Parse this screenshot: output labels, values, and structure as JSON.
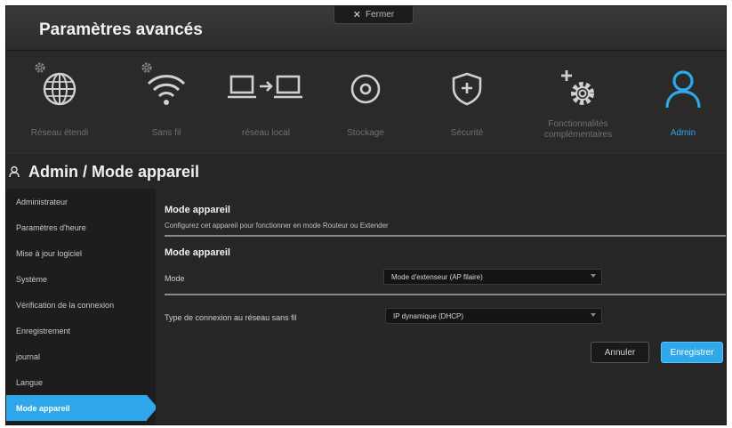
{
  "window": {
    "title": "Paramètres avancés",
    "close_label": "Fermer"
  },
  "nav": {
    "items": [
      {
        "label": "Réseau étendi",
        "icon": "globe-icon"
      },
      {
        "label": "Sans fil",
        "icon": "wifi-icon"
      },
      {
        "label": "réseau local",
        "icon": "lan-icon"
      },
      {
        "label": "Stockage",
        "icon": "storage-icon"
      },
      {
        "label": "Sécurité",
        "icon": "shield-icon"
      },
      {
        "label": "Fonctionnalités complémentaires",
        "icon": "gear-plus-icon"
      },
      {
        "label": "Admin",
        "icon": "user-icon"
      }
    ],
    "active_index": 6,
    "accent_color": "#2ea8ea"
  },
  "page": {
    "title": "Admin / Mode appareil"
  },
  "sidebar": {
    "items": [
      {
        "label": "Administrateur"
      },
      {
        "label": "Paramètres d'heure"
      },
      {
        "label": "Mise à jour logiciel"
      },
      {
        "label": "Système"
      },
      {
        "label": "Vérification de la connexion"
      },
      {
        "label": "Enregistrement"
      },
      {
        "label": "journal"
      },
      {
        "label": "Langue"
      },
      {
        "label": "Mode appareil"
      }
    ],
    "active_index": 8
  },
  "content": {
    "section1_title": "Mode appareil",
    "section1_desc": "Configurez cet appareil pour fonctionner en mode Routeur ou Extender",
    "section2_title": "Mode appareil",
    "mode_label": "Mode",
    "mode_value": "Mode d'extenseur (AP filaire)",
    "conn_label": "Type de connexion au réseau sans fil",
    "conn_value": "IP dynamique (DHCP)",
    "cancel_label": "Annuler",
    "save_label": "Enregistrer"
  }
}
